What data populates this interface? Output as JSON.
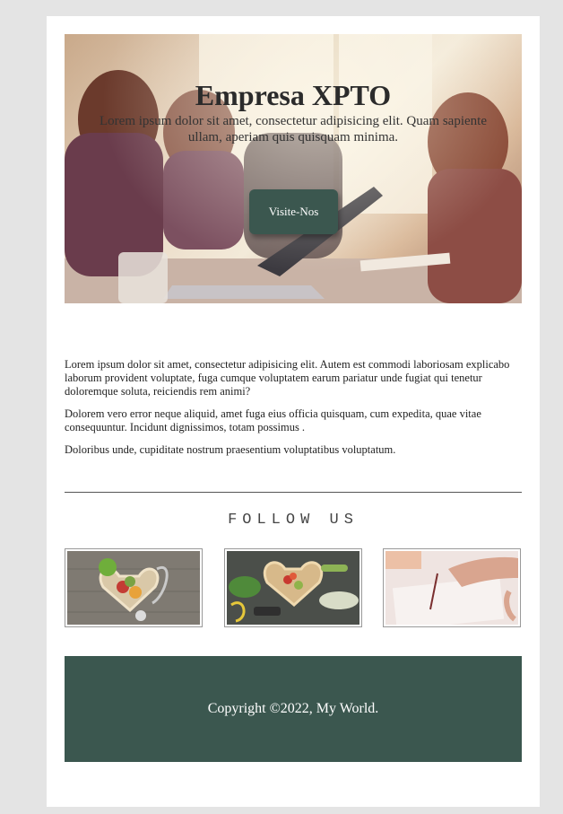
{
  "hero": {
    "title": "Empresa XPTO",
    "subtitle": "Lorem ipsum dolor sit amet, consectetur adipisicing elit. Quam sapiente ullam, aperiam quis quisquam minima.",
    "button_label": "Visite-Nos",
    "image": "team-meeting-photo"
  },
  "content": {
    "paragraphs": [
      "Lorem ipsum dolor sit amet, consectetur adipisicing elit. Autem est commodi laboriosam explicabo laborum provident voluptate, fuga cumque voluptatem earum pariatur unde fugiat qui tenetur doloremque soluta, reiciendis rem animi?",
      "Dolorem vero error neque aliquid, amet fuga eius officia quisquam, cum expedita, quae vitae consequuntur. Incidunt dignissimos, totam possimus .",
      "Doloribus unde, cupiditate nostrum praesentium voluptatibus voluptatum."
    ]
  },
  "follow": {
    "heading": "FOLLOW US",
    "images": [
      "heart-fruit-stethoscope-photo",
      "heart-vegetables-photo",
      "hand-drawing-photo"
    ]
  },
  "footer": {
    "copyright": "Copyright ©2022, My World."
  },
  "colors": {
    "accent": "#3b574f",
    "page_background": "#e4e4e4",
    "card_background": "#ffffff"
  }
}
